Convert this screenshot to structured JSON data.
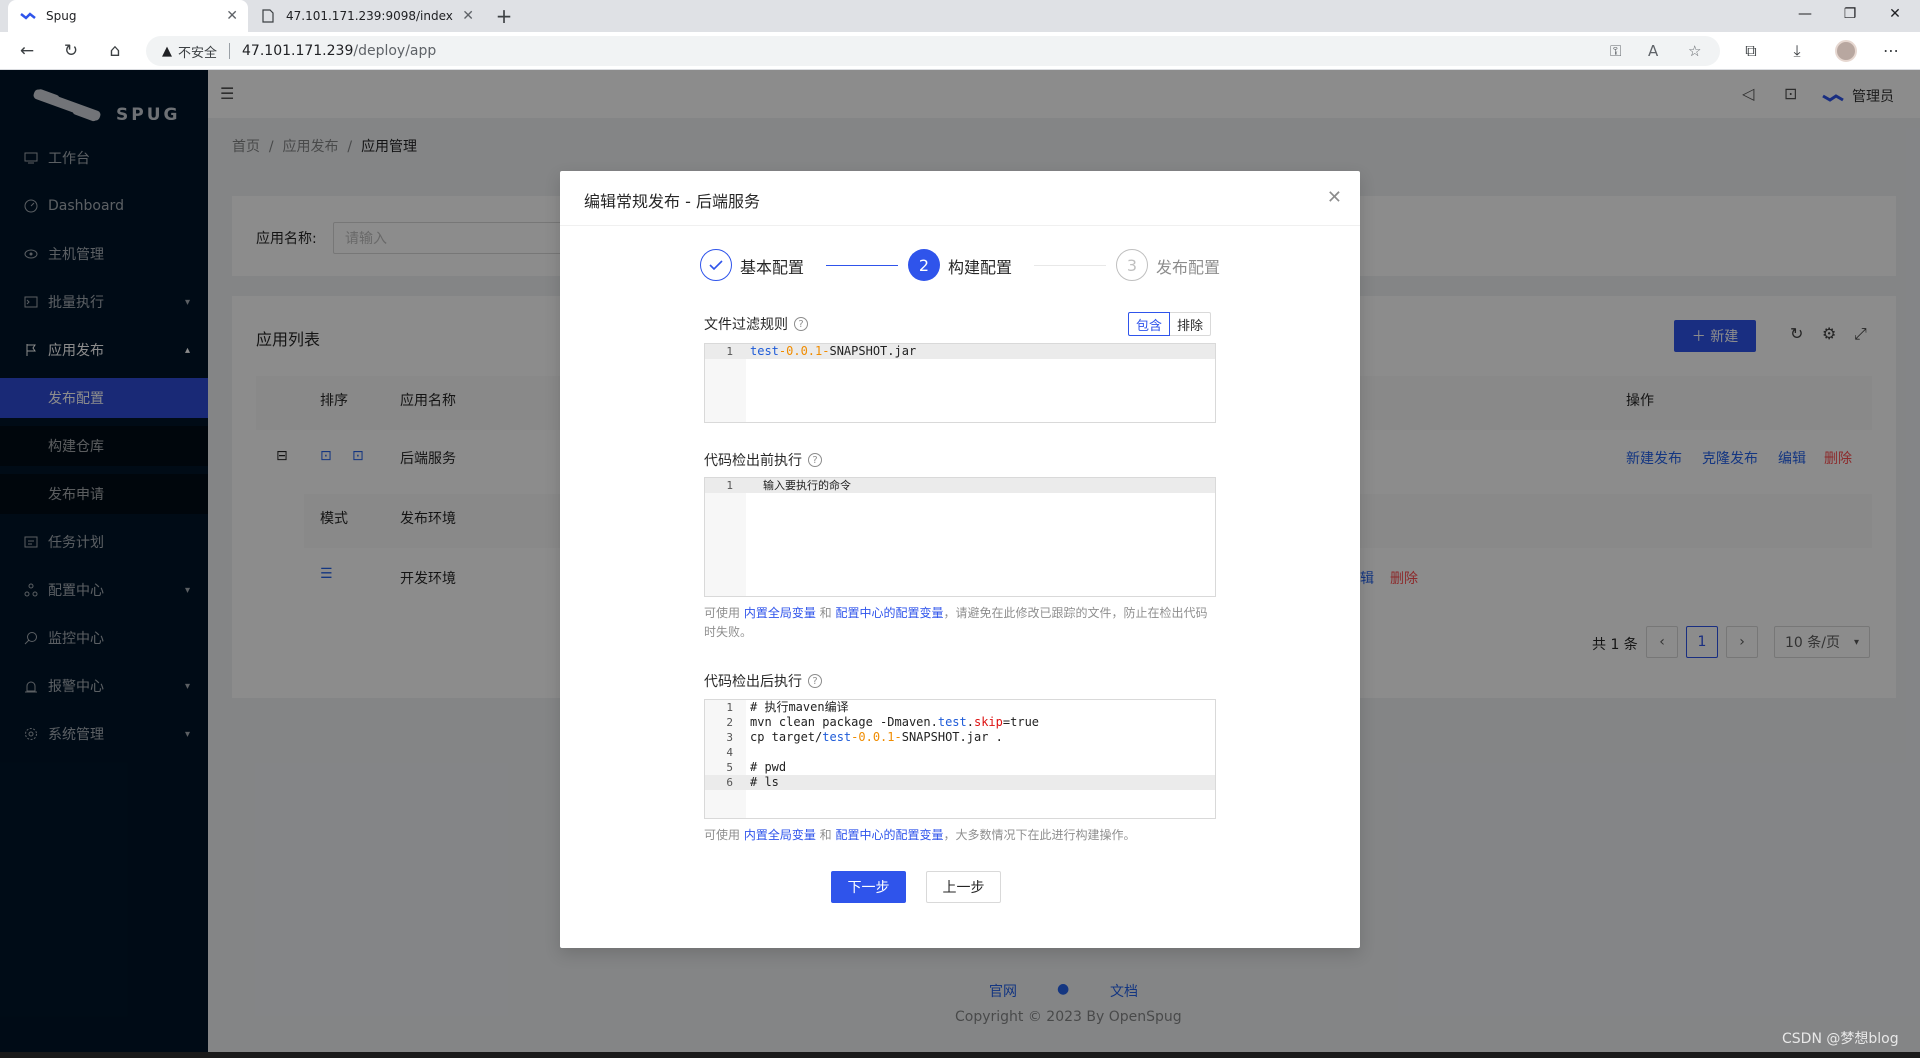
{
  "browser": {
    "tabs": [
      {
        "title": "Spug",
        "active": true
      },
      {
        "title": "47.101.171.239:9098/index",
        "active": false
      }
    ],
    "security_label": "不安全",
    "url_host": "47.101.171.239",
    "url_path": "/deploy/app"
  },
  "sidebar": {
    "logo_text": "SPUG",
    "items": [
      {
        "label": "工作台",
        "icon": "desktop-icon"
      },
      {
        "label": "Dashboard",
        "icon": "dashboard-icon"
      },
      {
        "label": "主机管理",
        "icon": "cloud-server-icon"
      },
      {
        "label": "批量执行",
        "icon": "terminal-icon"
      },
      {
        "label": "应用发布",
        "icon": "flag-icon"
      },
      {
        "label": "发布配置"
      },
      {
        "label": "构建仓库"
      },
      {
        "label": "发布申请"
      },
      {
        "label": "任务计划",
        "icon": "schedule-icon"
      },
      {
        "label": "配置中心",
        "icon": "deployment-icon"
      },
      {
        "label": "监控中心",
        "icon": "monitor-icon"
      },
      {
        "label": "报警中心",
        "icon": "alert-icon"
      },
      {
        "label": "系统管理",
        "icon": "setting-icon"
      }
    ]
  },
  "header": {
    "user": "管理员"
  },
  "page": {
    "breadcrumb": [
      "首页",
      "应用发布",
      "应用管理"
    ],
    "search_label": "应用名称:",
    "search_placeholder": "请输入",
    "list_title": "应用列表",
    "new_button": "新建",
    "table_headers": {
      "sort": "排序",
      "name": "应用名称",
      "ops": "操作"
    },
    "row": {
      "name": "后端服务",
      "actions": [
        "新建发布",
        "克隆发布",
        "编辑",
        "删除"
      ]
    },
    "sub_headers": {
      "mode": "模式",
      "env": "发布环境"
    },
    "sub_row": {
      "env": "开发环境",
      "edit": "辑",
      "delete": "删除"
    },
    "pagination": {
      "total": "共 1 条",
      "current": "1",
      "page_size": "10 条/页"
    },
    "footer": {
      "links": [
        "官网",
        "文档"
      ],
      "copyright": "Copyright © 2023 By OpenSpug"
    }
  },
  "watermark": "CSDN @梦想blog",
  "modal": {
    "title": "编辑常规发布 - 后端服务",
    "steps": [
      {
        "index": "1",
        "title": "基本配置",
        "status": "finish"
      },
      {
        "index": "2",
        "title": "构建配置",
        "status": "process"
      },
      {
        "index": "3",
        "title": "发布配置",
        "status": "wait"
      }
    ],
    "filter": {
      "label": "文件过滤规则",
      "options": [
        "包含",
        "排除"
      ],
      "selected": "包含",
      "line_number": "1",
      "code": {
        "a": "test",
        "b": "-0.0.1-",
        "c": "SNAPSHOT.jar"
      }
    },
    "pre_checkout": {
      "label": "代码检出前执行",
      "line_number": "1",
      "placeholder": "输入要执行的命令",
      "help_prefix": "可使用 ",
      "help_link1": "内置全局变量",
      "help_and": " 和 ",
      "help_link2": "配置中心的配置变量",
      "help_suffix": "，请避免在此修改已跟踪的文件，防止在检出代码时失败。"
    },
    "post_checkout": {
      "label": "代码检出后执行",
      "lines": [
        {
          "n": "1",
          "t": "# 执行maven编译"
        },
        {
          "n": "2",
          "a": "mvn clean package -Dmaven.",
          "b": "test",
          "c": ".",
          "d": "skip",
          "e": "=true"
        },
        {
          "n": "3",
          "a": "cp target/",
          "b": "test",
          "c": "-0.0.1-",
          "d": "SNAPSHOT.jar ."
        },
        {
          "n": "4",
          "t": ""
        },
        {
          "n": "5",
          "t": "# pwd"
        },
        {
          "n": "6",
          "t": "# ls"
        }
      ],
      "help_prefix": "可使用 ",
      "help_link1": "内置全局变量",
      "help_and": " 和 ",
      "help_link2": "配置中心的配置变量",
      "help_suffix": "，大多数情况下在此进行构建操作。"
    },
    "buttons": {
      "next": "下一步",
      "prev": "上一步"
    }
  }
}
